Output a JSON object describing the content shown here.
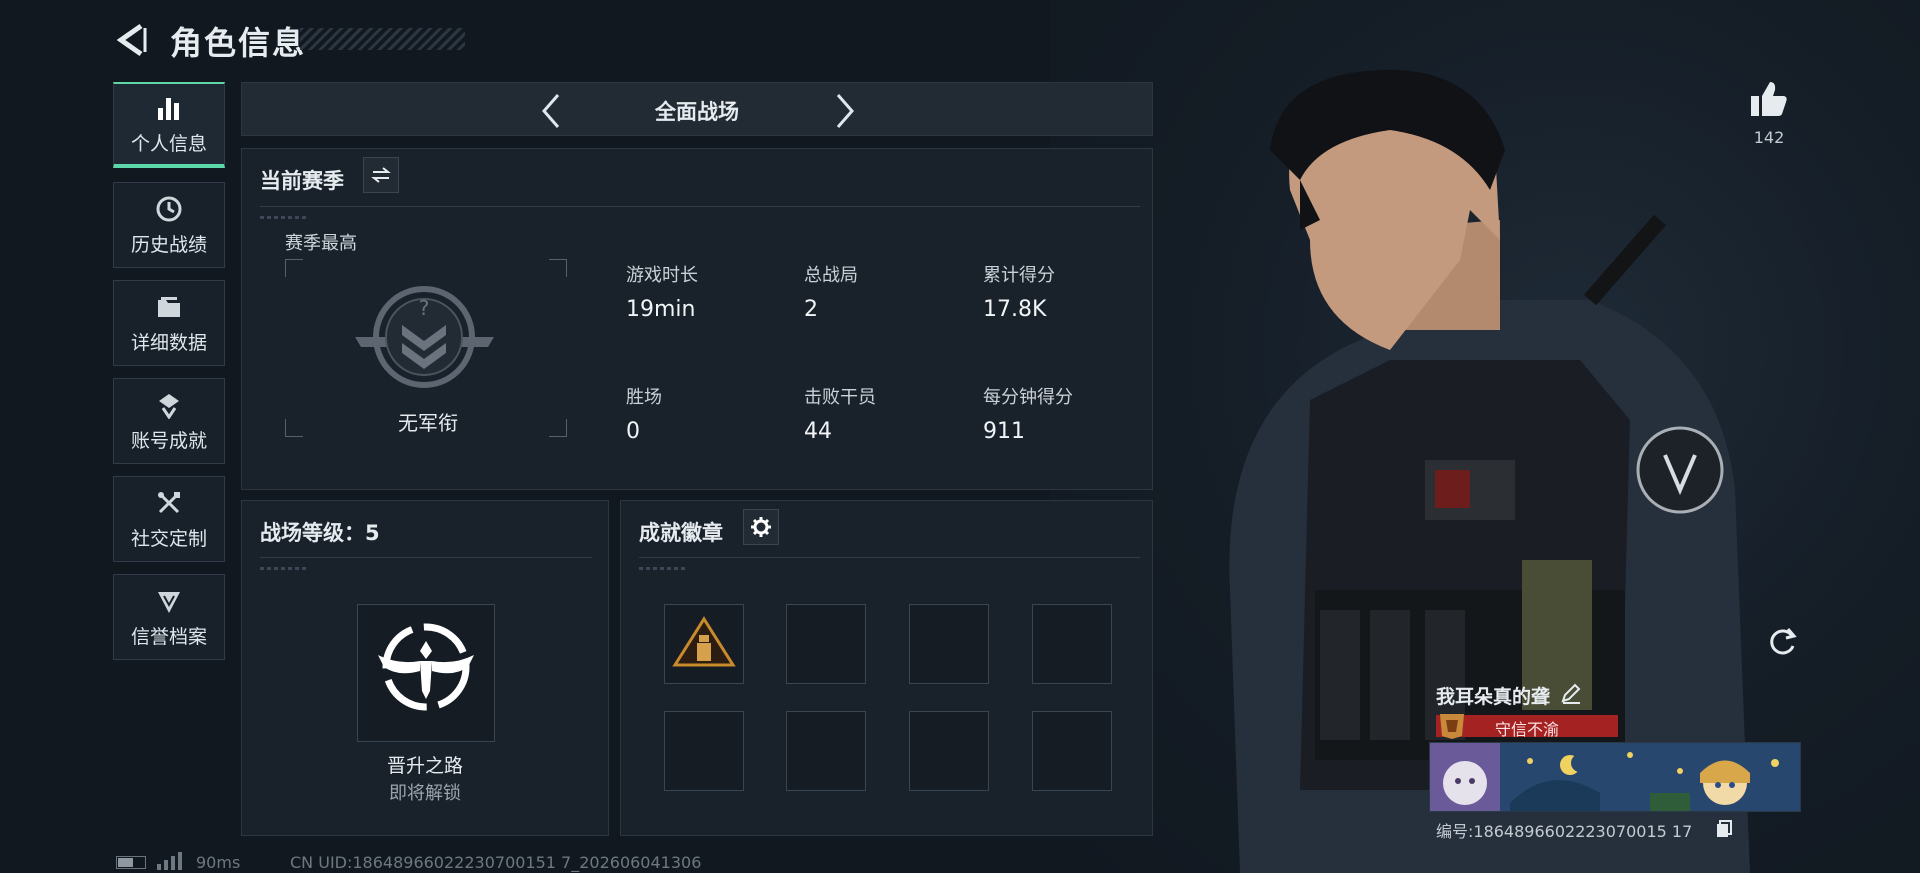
{
  "header": {
    "title": "角色信息"
  },
  "nav": {
    "items": [
      {
        "label": "个人信息",
        "icon": "bar-chart-icon",
        "active": true
      },
      {
        "label": "历史战绩",
        "icon": "clock-icon",
        "active": false
      },
      {
        "label": "详细数据",
        "icon": "folder-icon",
        "active": false
      },
      {
        "label": "账号成就",
        "icon": "medal-icon",
        "active": false
      },
      {
        "label": "社交定制",
        "icon": "tools-icon",
        "active": false
      },
      {
        "label": "信誉档案",
        "icon": "shield-icon",
        "active": false
      }
    ]
  },
  "mode": {
    "title": "全面战场"
  },
  "season": {
    "title": "当前赛季",
    "best_label": "赛季最高",
    "rank_name": "无军衔",
    "stats": [
      {
        "label": "游戏时长",
        "value": "19min"
      },
      {
        "label": "总战局",
        "value": "2"
      },
      {
        "label": "累计得分",
        "value": "17.8K"
      },
      {
        "label": "胜场",
        "value": "0"
      },
      {
        "label": "击败干员",
        "value": "44"
      },
      {
        "label": "每分钟得分",
        "value": "911"
      }
    ]
  },
  "level": {
    "title": "战场等级：5",
    "name": "晋升之路",
    "status": "即将解锁"
  },
  "badges": {
    "title": "成就徽章",
    "slots": 8,
    "filled": 1
  },
  "profile": {
    "likes": "142",
    "player_name": "我耳朵真的聋",
    "reputation": "守信不渝",
    "player_id": "编号:1864896602223070015 17"
  },
  "footer": {
    "ping": "90ms",
    "uid": "CN UID:18648966022230700151 7_202606041306"
  },
  "colors": {
    "accent": "#5dd6a9",
    "reputation": "#a42222",
    "background": "#111820"
  }
}
